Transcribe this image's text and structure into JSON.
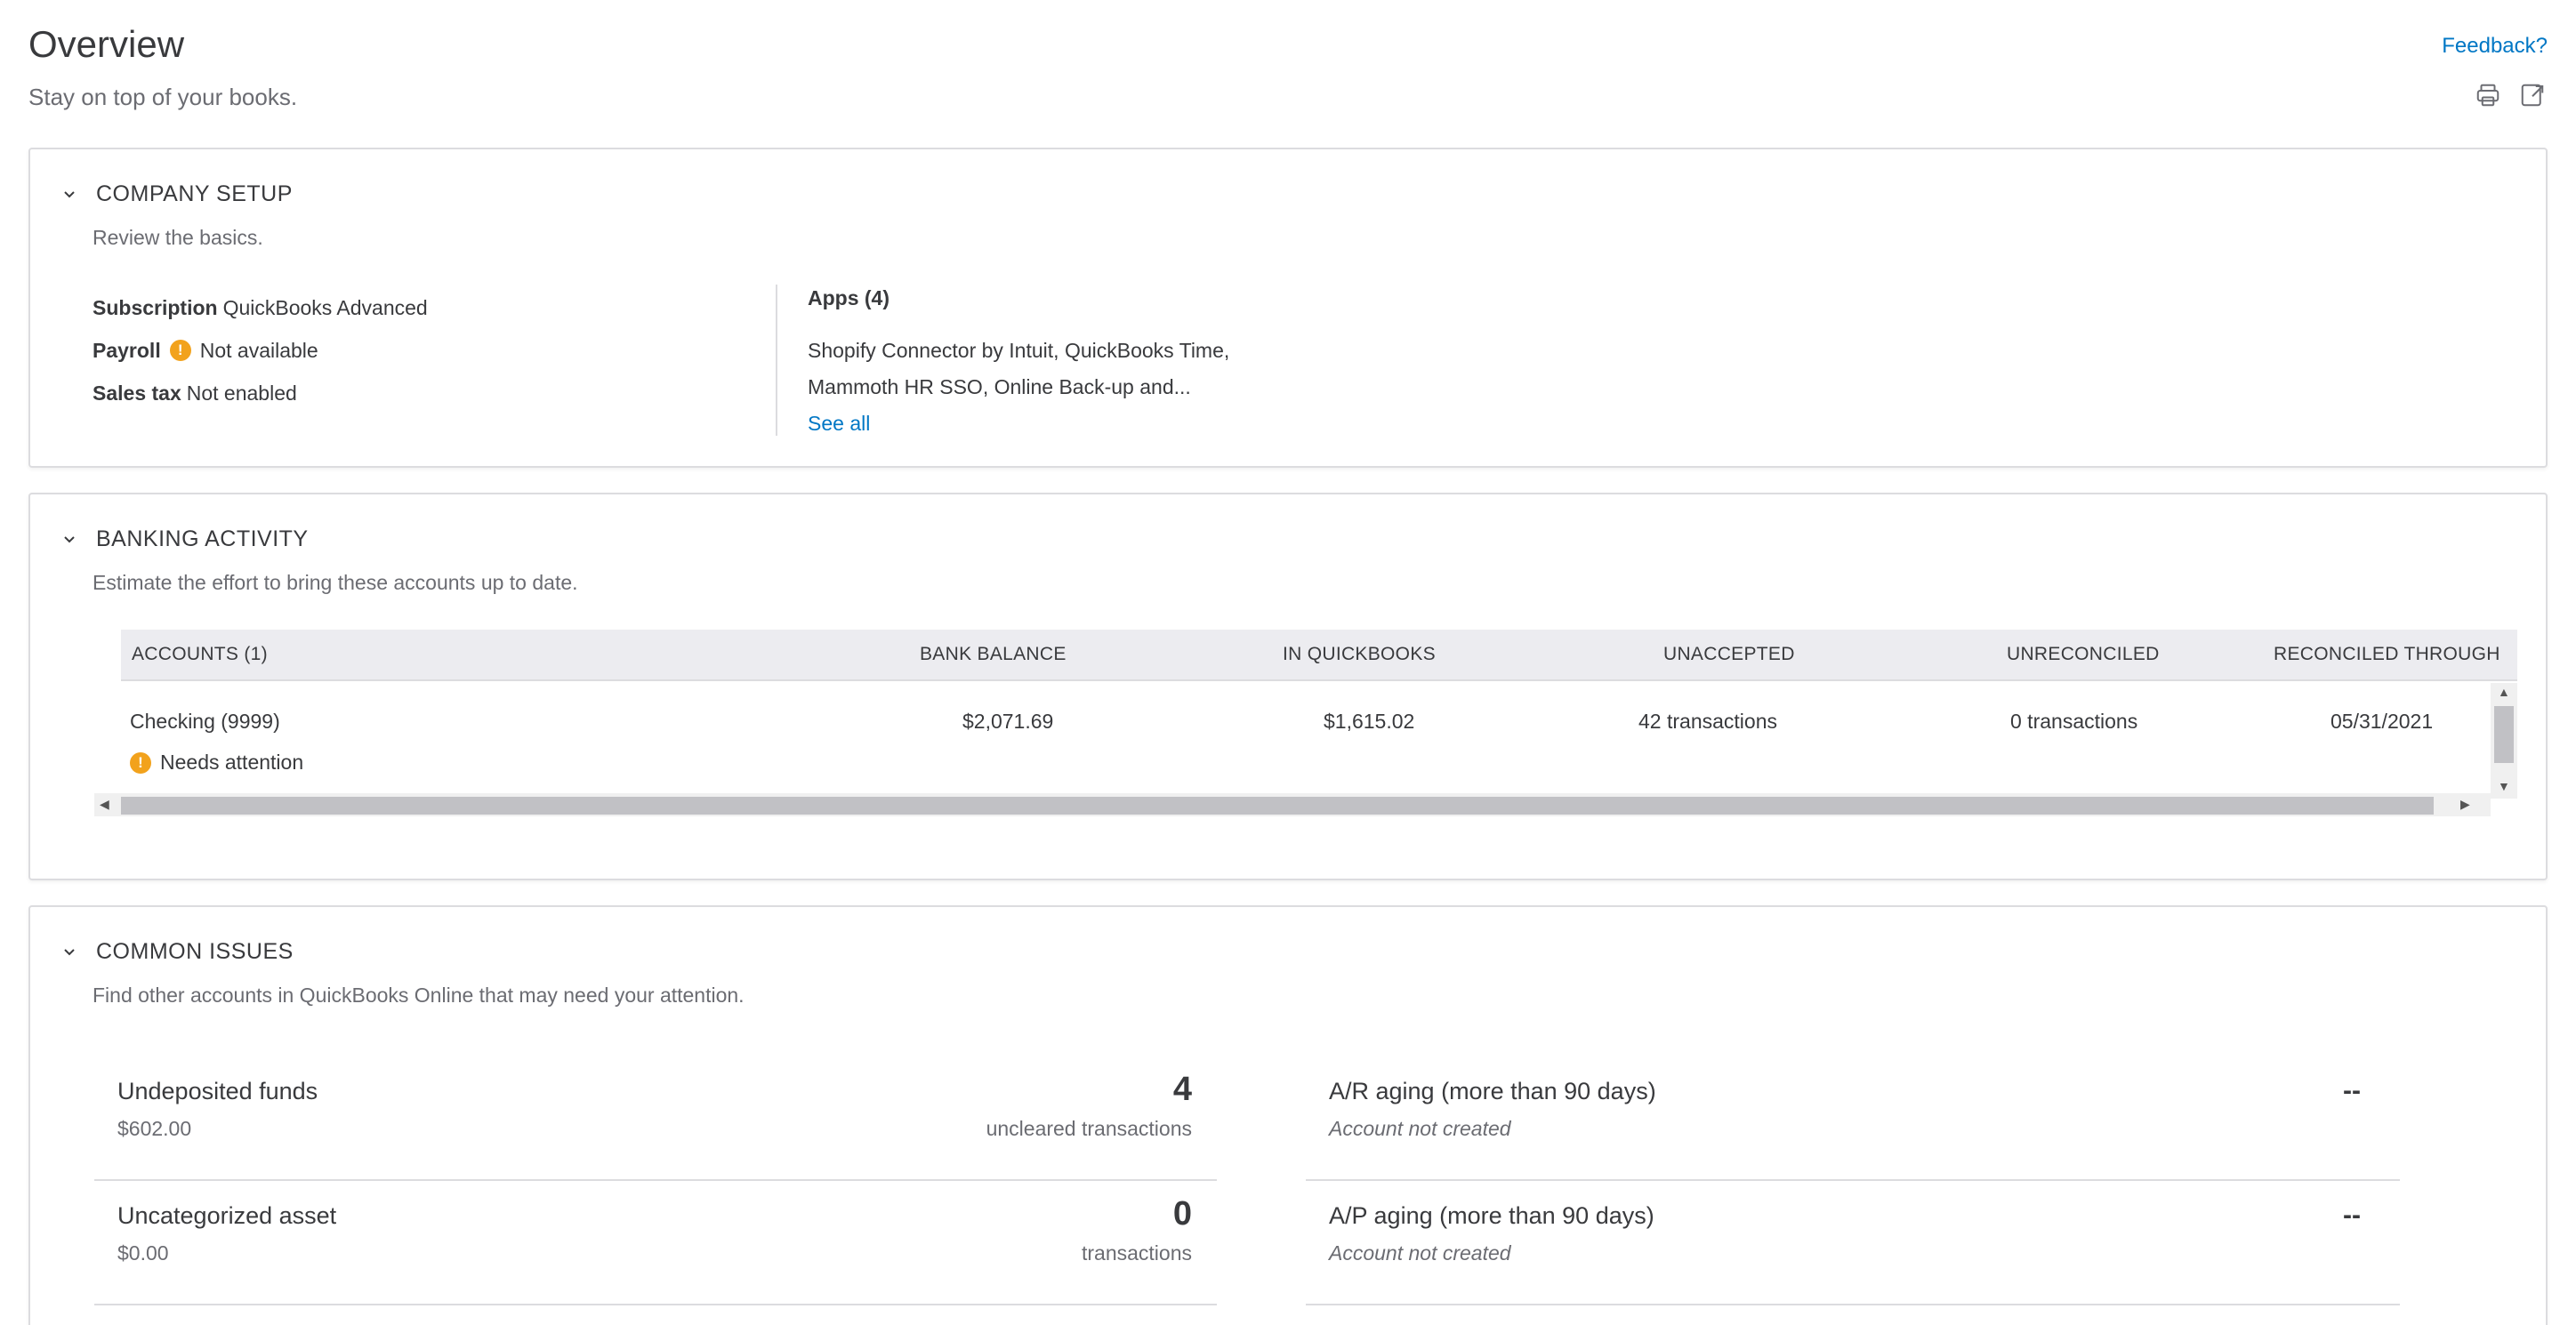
{
  "header": {
    "title": "Overview",
    "subtitle": "Stay on top of your books.",
    "feedback_label": "Feedback?",
    "icons": [
      "printer-icon",
      "export-icon"
    ]
  },
  "company_setup": {
    "title": "COMPANY SETUP",
    "description": "Review the basics.",
    "subscription_label": "Subscription",
    "subscription_value": "QuickBooks Advanced",
    "payroll_label": "Payroll",
    "payroll_value": "Not available",
    "sales_tax_label": "Sales tax",
    "sales_tax_value": "Not enabled",
    "apps_title": "Apps (4)",
    "apps_line1": "Shopify Connector by Intuit, QuickBooks Time,",
    "apps_line2": "Mammoth HR SSO, Online Back-up and...",
    "see_all_label": "See all"
  },
  "banking_activity": {
    "title": "BANKING ACTIVITY",
    "description": "Estimate the effort to bring these accounts up to date.",
    "columns": [
      "ACCOUNTS (1)",
      "BANK BALANCE",
      "IN QUICKBOOKS",
      "UNACCEPTED",
      "UNRECONCILED",
      "RECONCILED THROUGH"
    ],
    "rows": [
      {
        "account": "Checking (9999)",
        "bank_balance": "$2,071.69",
        "in_quickbooks": "$1,615.02",
        "unaccepted": "42 transactions",
        "unreconciled": "0 transactions",
        "reconciled_through": "05/31/2021",
        "status": "Needs attention"
      }
    ]
  },
  "common_issues": {
    "title": "COMMON ISSUES",
    "description": "Find other accounts in QuickBooks Online that may need your attention.",
    "left": [
      {
        "name": "Undeposited funds",
        "sub": "$602.00",
        "count": "4",
        "count_label": "uncleared transactions"
      },
      {
        "name": "Uncategorized asset",
        "sub": "$0.00",
        "count": "0",
        "count_label": "transactions"
      }
    ],
    "right": [
      {
        "name": "A/R aging (more than 90 days)",
        "sub": "Account not created",
        "value": "--"
      },
      {
        "name": "A/P aging (more than 90 days)",
        "sub": "Account not created",
        "value": "--"
      }
    ]
  },
  "colors": {
    "link": "#0077c5",
    "warning": "#f2a21c",
    "text": "#393a3d",
    "muted": "#6b6c72",
    "border": "#dcdcdf"
  }
}
